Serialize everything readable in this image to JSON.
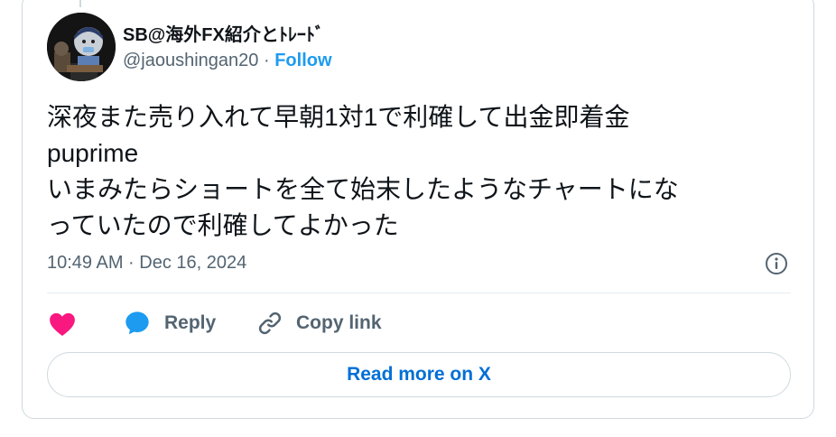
{
  "tweet": {
    "author_name": "SB@海外FX紹介とﾄﾚｰﾄﾞ",
    "handle": "@jaoushingan20",
    "separator": "·",
    "follow_label": "Follow",
    "text_lines": [
      "深夜また売り入れて早朝1対1で利確して出金即着金",
      "puprime",
      "いまみたらショートを全て始末したようなチャートにな",
      "っていたので利確してよかった"
    ],
    "timestamp": "10:49 AM · Dec 16, 2024"
  },
  "actions": {
    "like_icon": "heart-icon",
    "reply_icon": "speech-bubble-icon",
    "reply_label": "Reply",
    "copy_icon": "link-icon",
    "copy_label": "Copy link"
  },
  "read_more_label": "Read more on X",
  "colors": {
    "accent": "#1d9bf0",
    "link": "#006fd6",
    "like": "#f91880",
    "muted": "#536471",
    "border": "#cfd9de"
  }
}
